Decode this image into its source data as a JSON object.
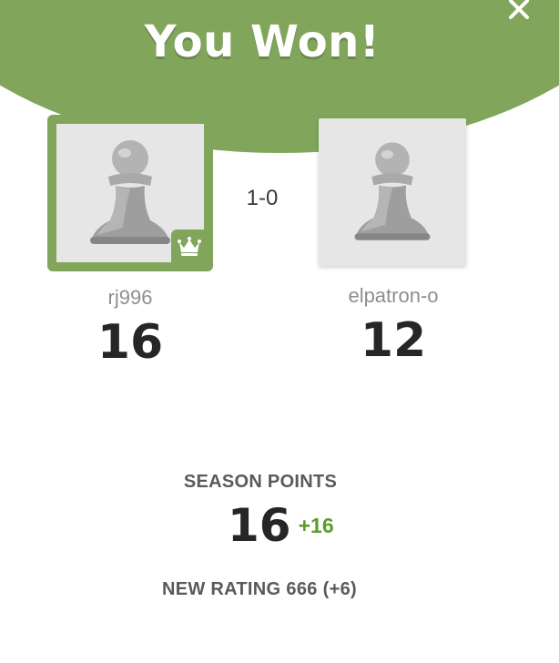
{
  "modal": {
    "title": "You Won!",
    "close_icon": "close-icon",
    "accent_color": "#81a65b"
  },
  "players": {
    "me": {
      "username": "rj996",
      "score": "16",
      "avatar_icon": "pawn-icon",
      "badge_icon": "crown-icon",
      "winner": true
    },
    "opponent": {
      "username": "elpatron-o",
      "score": "12",
      "avatar_icon": "pawn-icon"
    }
  },
  "result": "1-0",
  "season": {
    "label": "SEASON POINTS",
    "value": "16",
    "delta": "+16",
    "delta_color": "#5f9a2c"
  },
  "rating": {
    "label": "NEW RATING",
    "value": "666",
    "change": "(+6)"
  }
}
